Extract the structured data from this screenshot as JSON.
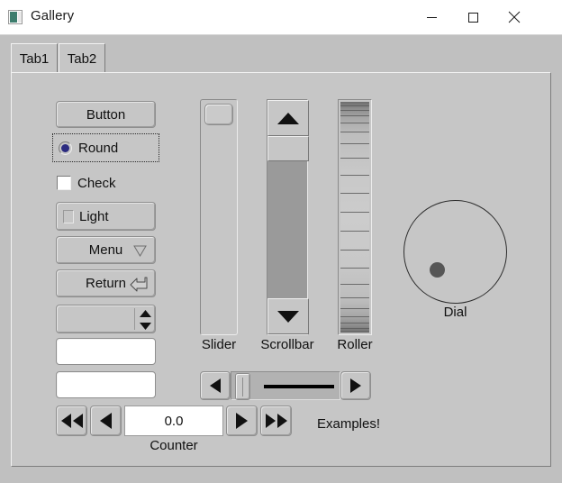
{
  "window": {
    "title": "Gallery",
    "icon": "app-window-icon",
    "controls": {
      "minimize": "minimize-icon",
      "maximize": "maximize-icon",
      "close": "close-icon"
    },
    "titlebar_bg": "#ffffff",
    "body_bg": "#c0c0c0",
    "widget_bg": "#c6c6c6"
  },
  "tabs": {
    "items": [
      {
        "label": "Tab1",
        "selected": true
      },
      {
        "label": "Tab2",
        "selected": false
      }
    ]
  },
  "controls": {
    "button": {
      "label": "Button"
    },
    "radio": {
      "label": "Round",
      "checked": true,
      "dot_color": "#2b2b80",
      "focused": true
    },
    "check": {
      "label": "Check",
      "checked": false
    },
    "light": {
      "label": "Light",
      "on": false
    },
    "menu": {
      "label": "Menu",
      "arrow": "triangle-down-icon"
    },
    "return": {
      "label": "Return",
      "arrow": "return-arrow-icon"
    },
    "spinner": {
      "value": "",
      "up_icon": "triangle-up-icon",
      "down_icon": "triangle-down-icon"
    },
    "input_1": {
      "value": "",
      "placeholder": ""
    },
    "input_2": {
      "value": "",
      "placeholder": ""
    },
    "counter": {
      "label": "Counter",
      "value": "0.0",
      "fast_rewind": "double-left-arrow-icon",
      "rewind": "left-arrow-icon",
      "forward": "right-arrow-icon",
      "fast_forward": "double-right-arrow-icon"
    }
  },
  "sliders": {
    "slider": {
      "label": "Slider",
      "orientation": "vertical",
      "thumb_position_pct": 0
    },
    "scrollbar": {
      "label": "Scrollbar",
      "orientation": "vertical",
      "thumb_position_pct": 0,
      "up_icon": "triangle-up-icon",
      "down_icon": "triangle-down-icon"
    },
    "roller": {
      "label": "Roller",
      "orientation": "vertical"
    },
    "value_slider": {
      "orientation": "horizontal",
      "thumb_position_pct": 2,
      "left_icon": "left-arrow-icon",
      "right_icon": "right-arrow-icon"
    }
  },
  "dial": {
    "label": "Dial",
    "knob_color": "#565656",
    "angle_deg": 215
  },
  "examples": {
    "text": "Examples!"
  }
}
